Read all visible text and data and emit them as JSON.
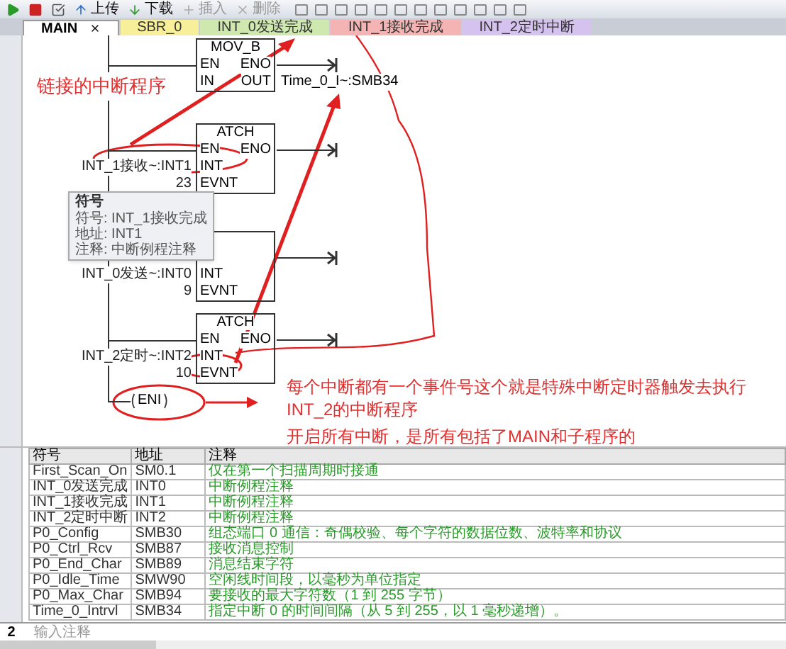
{
  "toolbar": {
    "buttons": [
      {
        "label": "上传",
        "disabled": false
      },
      {
        "label": "下载",
        "disabled": false
      },
      {
        "label": "插入",
        "disabled": true
      },
      {
        "label": "删除",
        "disabled": true
      }
    ]
  },
  "tabs": [
    {
      "label": "MAIN",
      "selected": true,
      "color": "#ffffff",
      "closable": true
    },
    {
      "label": "SBR_0",
      "selected": false,
      "color": "#f7ef9a",
      "closable": false
    },
    {
      "label": "INT_0发送完成",
      "selected": false,
      "color": "#cfe8b0",
      "closable": false
    },
    {
      "label": "INT_1接收完成",
      "selected": false,
      "color": "#f4b4b4",
      "closable": false
    },
    {
      "label": "INT_2定时中断",
      "selected": false,
      "color": "#d6c2ef",
      "closable": false
    }
  ],
  "ladder": {
    "blocks": [
      {
        "title": "MOV_B",
        "rows": [
          {
            "in": "EN",
            "out": "ENO",
            "eno": true
          },
          {
            "in": "IN",
            "out": "OUT",
            "out_operand": "Time_0_I~:SMB34"
          }
        ]
      },
      {
        "title": "ATCH",
        "rows": [
          {
            "in": "EN",
            "out": "ENO",
            "eno": true
          },
          {
            "in": "INT",
            "operand": "INT_1接收~:INT1"
          },
          {
            "in": "EVNT",
            "operand": "23"
          }
        ]
      },
      {
        "rows": [
          {
            "eno": true
          },
          {
            "in": "INT",
            "operand": "INT_0发送~:INT0"
          },
          {
            "in": "EVNT",
            "operand": "9"
          }
        ]
      },
      {
        "title": "ATCH",
        "rows": [
          {
            "in": "EN",
            "out": "ENO",
            "eno": true
          },
          {
            "in": "INT",
            "operand": "INT_2定时~:INT2"
          },
          {
            "in": "EVNT",
            "operand": "10"
          }
        ]
      }
    ],
    "coil": "ENI",
    "tooltip": {
      "title": "符号",
      "lines": [
        "符号: INT_1接收完成",
        "地址: INT1",
        "注释: 中断例程注释"
      ]
    },
    "annotations": [
      "链接的中断程序",
      "每个中断都有一个事件号这个就是特殊中断定时器触发去执行INT_2的中断程序",
      "开启所有中断，是所有包括了MAIN和子程序的"
    ]
  },
  "symbol_table": {
    "columns": [
      "符号",
      "地址",
      "注释"
    ],
    "rows": [
      [
        "First_Scan_On",
        "SM0.1",
        "仅在第一个扫描周期时接通"
      ],
      [
        "INT_0发送完成",
        "INT0",
        "中断例程注释"
      ],
      [
        "INT_1接收完成",
        "INT1",
        "中断例程注释"
      ],
      [
        "INT_2定时中断",
        "INT2",
        "中断例程注释"
      ],
      [
        "P0_Config",
        "SMB30",
        "组态端口 0 通信：奇偶校验、每个字符的数据位数、波特率和协议"
      ],
      [
        "P0_Ctrl_Rcv",
        "SMB87",
        "接收消息控制"
      ],
      [
        "P0_End_Char",
        "SMB89",
        "消息结束字符"
      ],
      [
        "P0_Idle_Time",
        "SMW90",
        "空闲线时间段，以毫秒为单位指定"
      ],
      [
        "P0_Max_Char",
        "SMB94",
        "要接收的最大字符数（1 到 255 字节）"
      ],
      [
        "Time_0_Intrvl",
        "SMB34",
        "指定中断 0 的时间间隔（从 5 到 255，以 1 毫秒递增）。"
      ]
    ]
  },
  "network2": {
    "number": "2",
    "comment": "输入注释"
  }
}
